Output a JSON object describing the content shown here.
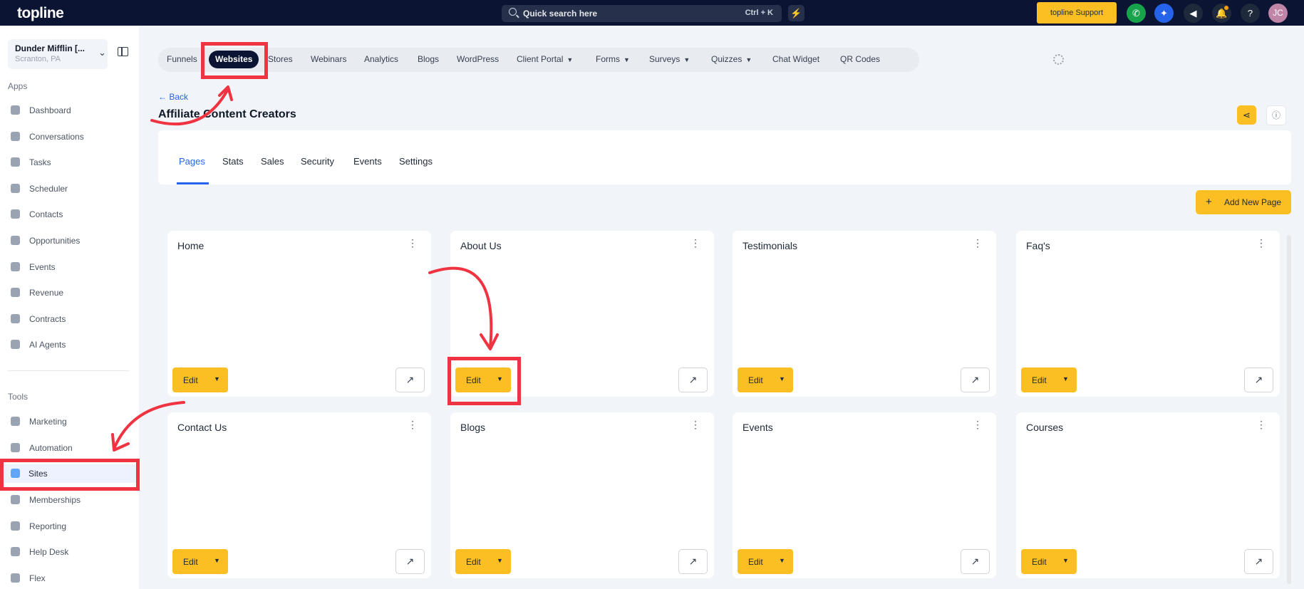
{
  "topbar": {
    "logo": "topline",
    "search_placeholder": "Quick search here",
    "search_shortcut": "Ctrl + K",
    "support_label": "topline Support",
    "avatar_initials": "JC"
  },
  "sidebar": {
    "account_name": "Dunder Mifflin [...",
    "account_location": "Scranton, PA",
    "apps_label": "Apps",
    "tools_label": "Tools",
    "apps": [
      "Dashboard",
      "Conversations",
      "Tasks",
      "Scheduler",
      "Contacts",
      "Opportunities",
      "Events",
      "Revenue",
      "Contracts",
      "AI Agents"
    ],
    "tools": [
      "Marketing",
      "Automation",
      "Sites",
      "Memberships",
      "Reporting",
      "Help Desk",
      "Flex"
    ],
    "active_item": "Sites"
  },
  "product_tabs": [
    {
      "label": "Funnels",
      "dropdown": false
    },
    {
      "label": "Websites",
      "dropdown": false
    },
    {
      "label": "Stores",
      "dropdown": false
    },
    {
      "label": "Webinars",
      "dropdown": false
    },
    {
      "label": "Analytics",
      "dropdown": false
    },
    {
      "label": "Blogs",
      "dropdown": false
    },
    {
      "label": "WordPress",
      "dropdown": false
    },
    {
      "label": "Client Portal",
      "dropdown": true
    },
    {
      "label": "Forms",
      "dropdown": true
    },
    {
      "label": "Surveys",
      "dropdown": true
    },
    {
      "label": "Quizzes",
      "dropdown": true
    },
    {
      "label": "Chat Widget",
      "dropdown": false
    },
    {
      "label": "QR Codes",
      "dropdown": false
    }
  ],
  "active_product_tab": "Websites",
  "back_label": "← Back",
  "page_title": "Affiliate Content Creators",
  "sub_tabs": [
    "Pages",
    "Stats",
    "Sales",
    "Security",
    "Events",
    "Settings"
  ],
  "active_sub_tab": "Pages",
  "add_page_label": "Add New Page",
  "edit_label": "Edit",
  "pages": [
    "Home",
    "About Us",
    "Testimonials",
    "Faq's",
    "Contact Us",
    "Blogs",
    "Events",
    "Courses"
  ],
  "colors": {
    "accent_yellow": "#fbbf24",
    "navy": "#0b1533",
    "annotation_red": "#ef3340",
    "link_blue": "#2563eb"
  }
}
